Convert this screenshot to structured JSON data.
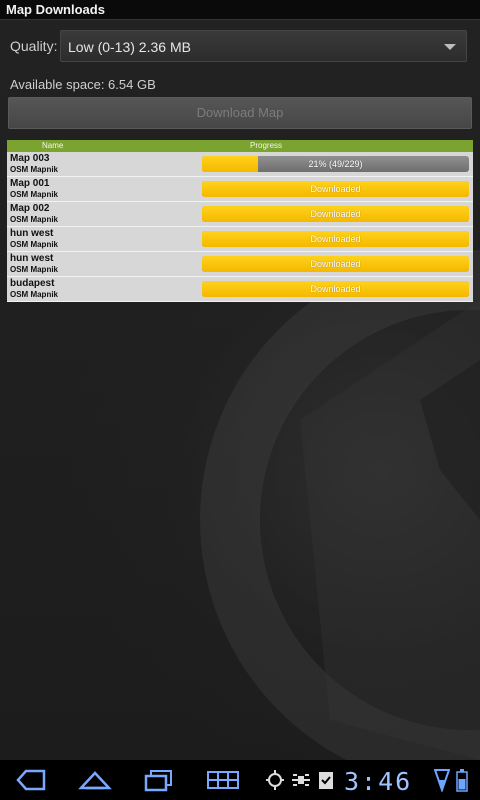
{
  "app": {
    "title": "Map Downloads"
  },
  "quality": {
    "label": "Quality:",
    "selected": "Low (0-13) 2.36 MB"
  },
  "available_space": "Available space: 6.54 GB",
  "download_button": {
    "label": "Download Map",
    "enabled": false
  },
  "table": {
    "headers": {
      "name": "Name",
      "progress": "Progress"
    },
    "rows": [
      {
        "name": "Map 003",
        "source": "OSM Mapnik",
        "progress_text": "21% (49/229)",
        "progress": 0.21
      },
      {
        "name": "Map 001",
        "source": "OSM Mapnik",
        "progress_text": "Downloaded",
        "progress": 1.0
      },
      {
        "name": "Map 002",
        "source": "OSM Mapnik",
        "progress_text": "Downloaded",
        "progress": 1.0
      },
      {
        "name": "hun west",
        "source": "OSM Mapnik",
        "progress_text": "Downloaded",
        "progress": 1.0
      },
      {
        "name": "hun west",
        "source": "OSM Mapnik",
        "progress_text": "Downloaded",
        "progress": 1.0
      },
      {
        "name": "budapest",
        "source": "OSM Mapnik",
        "progress_text": "Downloaded",
        "progress": 1.0
      }
    ]
  },
  "system_bar": {
    "time": "3:46",
    "icons": [
      "back-icon",
      "home-icon",
      "recent-apps-icon",
      "menu-grid-icon",
      "gps-icon",
      "satellite-icon",
      "clipboard-check-icon",
      "signal-icon",
      "battery-icon"
    ],
    "accent": "#6ea6ff"
  },
  "colors": {
    "header_green": "#7aa32f",
    "progress_yellow": "#ffc600",
    "row_bg": "#d7d7d7"
  }
}
